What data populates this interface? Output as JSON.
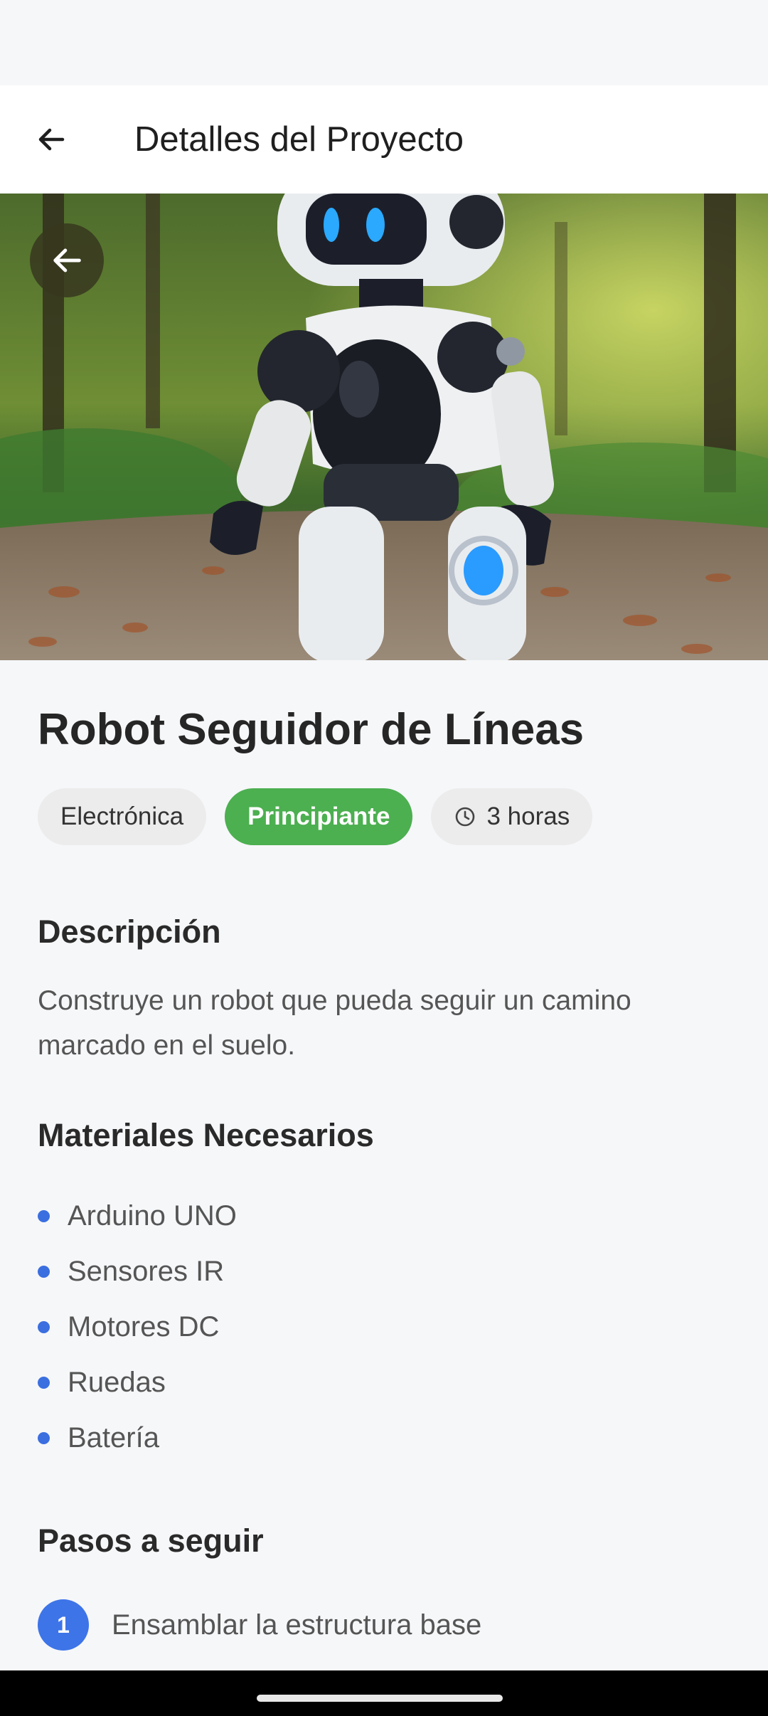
{
  "header": {
    "title": "Detalles del Proyecto",
    "back_icon": "arrow-left-icon"
  },
  "hero": {
    "image_subject": "white and black humanoid robot on forest path",
    "back_icon": "arrow-left-icon"
  },
  "project": {
    "title": "Robot Seguidor de Líneas",
    "category": "Electrónica",
    "level": "Principiante",
    "duration": "3 horas",
    "duration_icon": "clock-icon",
    "level_color": "#4caf50"
  },
  "description": {
    "heading": "Descripción",
    "text": "Construye un robot que pueda seguir un camino marcado en el suelo."
  },
  "materials": {
    "heading": "Materiales Necesarios",
    "items": [
      "Arduino UNO",
      "Sensores IR",
      "Motores DC",
      "Ruedas",
      "Batería"
    ],
    "bullet_color": "#3b6fe0"
  },
  "steps": {
    "heading": "Pasos a seguir",
    "items": [
      {
        "number": "1",
        "text": "Ensamblar la estructura base"
      }
    ],
    "accent": "#3d74e8"
  }
}
